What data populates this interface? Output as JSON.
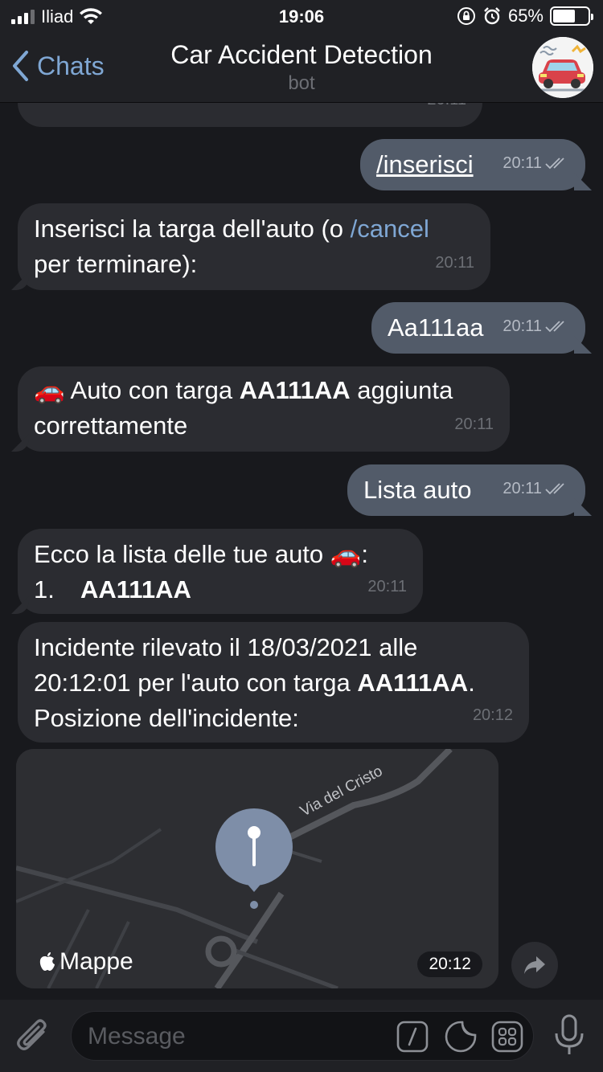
{
  "status": {
    "carrier": "Iliad",
    "time": "19:06",
    "battery": "65%",
    "battery_fraction": 0.65
  },
  "header": {
    "back_label": "Chats",
    "title": "Car Accident Detection",
    "subtitle": "bot"
  },
  "messages": {
    "prev_time": "20:11",
    "m1": {
      "text": "/inserisci",
      "time": "20:11"
    },
    "m2": {
      "before": "Inserisci la targa dell'auto (o ",
      "link": "/cancel",
      "after": "per terminare):",
      "time": "20:11"
    },
    "m3": {
      "text": "Aa111aa",
      "time": "20:11"
    },
    "m4": {
      "emoji": "🚗",
      "before": " Auto con targa ",
      "plate": "AA111AA",
      "after": " aggiunta",
      "line2": "correttamente",
      "time": "20:11"
    },
    "m5": {
      "text": "Lista auto",
      "time": "20:11"
    },
    "m6": {
      "line1": "Ecco la lista delle tue auto ",
      "emoji": "🚗",
      "colon": ":",
      "item_num": "1.",
      "item_plate": "AA111AA",
      "time": "20:11"
    },
    "m7": {
      "line1": "Incidente rilevato il 18/03/2021 alle",
      "line2_before": "20:12:01 per l'auto con targa ",
      "plate": "AA111AA",
      "line2_after": ".",
      "line3": "Posizione dell'incidente:",
      "time": "20:12"
    }
  },
  "map": {
    "street": "Via del Cristo",
    "brand": "Mappe",
    "time": "20:12"
  },
  "input": {
    "placeholder": "Message"
  },
  "colors": {
    "accent": "#7fa7d4",
    "outgoing": "#525b69",
    "incoming": "#2b2c31"
  }
}
